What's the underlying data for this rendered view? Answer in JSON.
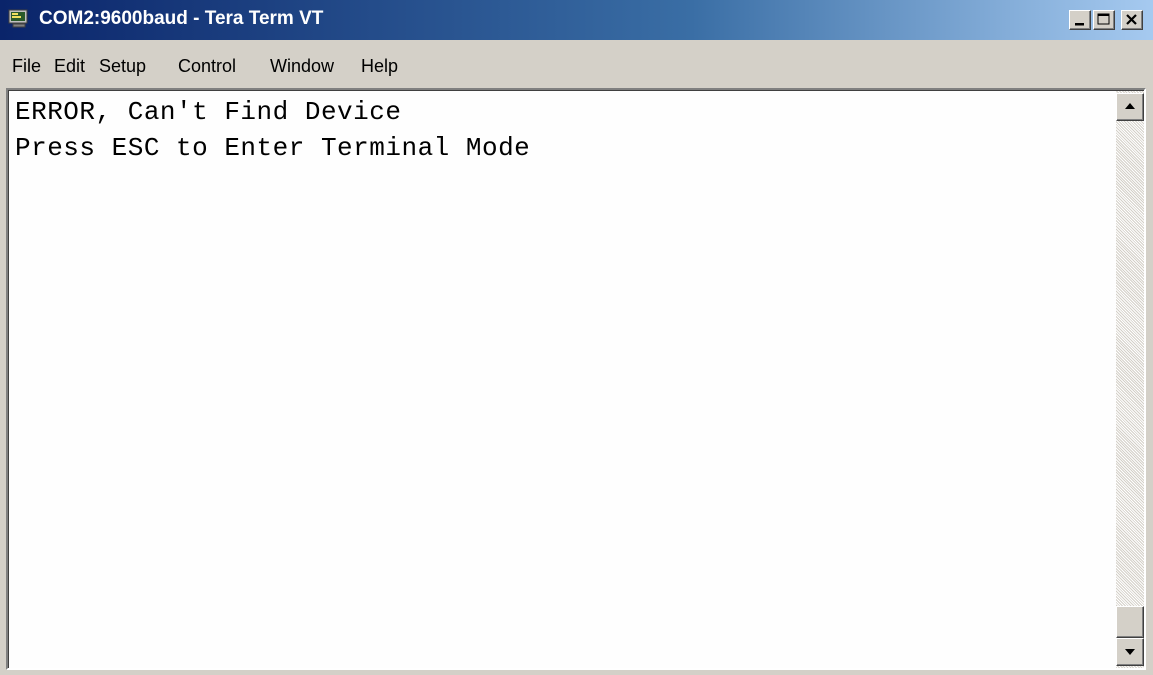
{
  "window": {
    "title": "COM2:9600baud - Tera Term VT",
    "title_gradient": [
      "#0a246a",
      "#a6caf0"
    ]
  },
  "menu": {
    "items": [
      {
        "label": "File"
      },
      {
        "label": "Edit"
      },
      {
        "label": "Setup"
      },
      {
        "label": "Control"
      },
      {
        "label": "Window"
      },
      {
        "label": "Help"
      }
    ]
  },
  "terminal": {
    "lines": [
      "ERROR, Can't Find Device",
      "Press ESC to Enter Terminal Mode"
    ],
    "background": "#fefefe",
    "text_color": "#000000"
  },
  "icons": {
    "app": "tera-term-app-icon",
    "minimize": "minimize-icon",
    "maximize": "maximize-icon",
    "close": "close-icon",
    "scroll_up": "arrow-up-icon",
    "scroll_down": "arrow-down-icon"
  }
}
